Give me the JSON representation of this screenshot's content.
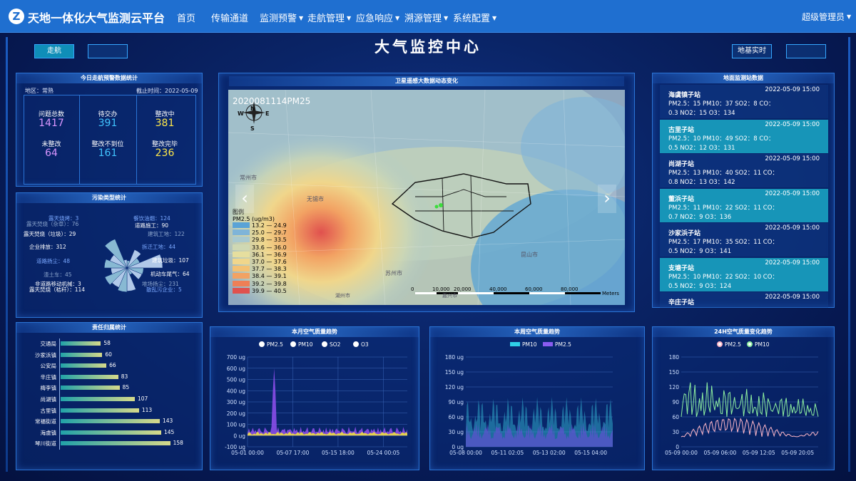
{
  "app": {
    "title": "天地一体化大气监测云平台",
    "logo_glyph": "Z"
  },
  "nav": {
    "items": [
      {
        "label": "首页",
        "dropdown": false
      },
      {
        "label": "传输通道",
        "dropdown": false
      },
      {
        "label": "监测预警",
        "dropdown": true
      },
      {
        "label": "走航管理",
        "dropdown": true
      },
      {
        "label": "应急响应",
        "dropdown": true
      },
      {
        "label": "溯源管理",
        "dropdown": true
      },
      {
        "label": "系统配置",
        "dropdown": true
      }
    ],
    "user": "超级管理员"
  },
  "page": {
    "title": "大气监控中心",
    "tab_left": "走航",
    "tab_right": "地基实时"
  },
  "alarm_panel": {
    "title": "今日走航预警数据统计",
    "region": "地区：常熟",
    "deadline": "截止时间：2022-05-09",
    "stats": [
      {
        "label": "问题总数",
        "value": "1417",
        "color": "#d996ff"
      },
      {
        "label": "待交办",
        "value": "391",
        "color": "#41c4ff"
      },
      {
        "label": "整改中",
        "value": "381",
        "color": "#ffe84a"
      },
      {
        "label": "未整改",
        "value": "64",
        "color": "#d996ff"
      },
      {
        "label": "整改不到位",
        "value": "161",
        "color": "#41c4ff"
      },
      {
        "label": "整改完毕",
        "value": "236",
        "color": "#ffe84a"
      }
    ]
  },
  "pollution_panel": {
    "title": "污染类型统计",
    "items": [
      {
        "text": "露天烧烤：3",
        "value": 3,
        "color": "#7aa8ff"
      },
      {
        "text": "露天焚烧（杂草）：76",
        "value": 76,
        "color": "#8ba5cc"
      },
      {
        "text": "露天焚烧（垃圾）：29",
        "value": 29,
        "color": "#ffffff"
      },
      {
        "text": "企业排放：312",
        "value": 312,
        "color": "#ffffff"
      },
      {
        "text": "道路扬尘：48",
        "value": 48,
        "color": "#7aa8ff"
      },
      {
        "text": "渣土车：45",
        "value": 45,
        "color": "#8ba5cc"
      },
      {
        "text": "非道路移动机械：3",
        "value": 3,
        "color": "#ffffff"
      },
      {
        "text": "露天焚烧（秸秆）：114",
        "value": 114,
        "color": "#ffffff"
      },
      {
        "text": "餐饮油烟：124",
        "value": 124,
        "color": "#7aa8ff"
      },
      {
        "text": "道路施工：90",
        "value": 90,
        "color": "#ffffff"
      },
      {
        "text": "建筑工地：122",
        "value": 122,
        "color": "#8ba5cc"
      },
      {
        "text": "拆迁工地：44",
        "value": 44,
        "color": "#7aa8ff"
      },
      {
        "text": "建筑垃圾：107",
        "value": 107,
        "color": "#ffffff"
      },
      {
        "text": "机动车尾气：64",
        "value": 64,
        "color": "#ffffff"
      },
      {
        "text": "堆场扬尘：231",
        "value": 231,
        "color": "#8ba5cc"
      },
      {
        "text": "散乱污企业：5",
        "value": 5,
        "color": "#7aa8ff"
      }
    ]
  },
  "map_panel": {
    "title": "卫星遥感大数据动态变化",
    "stamp": "2020081114PM25",
    "compass": {
      "n": "N",
      "s": "S",
      "e": "E",
      "w": "W"
    },
    "prev_label": "‹",
    "next_label": "›",
    "legend_title": "图例",
    "legend_unit": "PM2.5 (ug/m3)",
    "legend": [
      {
        "range": "13.2 — 24.9",
        "color": "#5aa3d6"
      },
      {
        "range": "25.0 — 29.7",
        "color": "#7fb4d8"
      },
      {
        "range": "29.8 — 33.5",
        "color": "#a9c9cf"
      },
      {
        "range": "33.6 — 36.0",
        "color": "#cfd8b3"
      },
      {
        "range": "36.1 — 36.9",
        "color": "#e6de9e"
      },
      {
        "range": "37.0 — 37.6",
        "color": "#f0d68b"
      },
      {
        "range": "37.7 — 38.3",
        "color": "#f3c173"
      },
      {
        "range": "38.4 — 39.1",
        "color": "#f2a263"
      },
      {
        "range": "39.2 — 39.8",
        "color": "#ee7f56"
      },
      {
        "range": "39.9 — 40.5",
        "color": "#e0514e"
      }
    ],
    "scale_ticks": [
      "0",
      "10,000",
      "20,000",
      "40,000",
      "60,000",
      "80,000"
    ],
    "scale_unit": "Meters",
    "place_labels": [
      "常州市",
      "无锡市",
      "苏州市",
      "昆山市",
      "嘉兴市",
      "湖州市"
    ]
  },
  "station_panel": {
    "title": "地面监测站数据",
    "stations": [
      {
        "name": "海虞镇子站",
        "time": "2022-05-09 15:00",
        "line1": "PM2.5：15 PM10：37 SO2：8 CO：",
        "line2": "0.3 NO2：15 O3：134",
        "highlight": false
      },
      {
        "name": "古里子站",
        "time": "2022-05-09 15:00",
        "line1": "PM2.5：10 PM10：49 SO2：8 CO：",
        "line2": "0.5 NO2：12 O3：131",
        "highlight": true
      },
      {
        "name": "尚湖子站",
        "time": "2022-05-09 15:00",
        "line1": "PM2.5：13 PM10：40 SO2：11 CO：",
        "line2": "0.8 NO2：13 O3：142",
        "highlight": false
      },
      {
        "name": "董浜子站",
        "time": "2022-05-09 15:00",
        "line1": "PM2.5：11 PM10：22 SO2：11 CO：",
        "line2": "0.7 NO2：9 O3：136",
        "highlight": true
      },
      {
        "name": "沙家浜子站",
        "time": "2022-05-09 15:00",
        "line1": "PM2.5：17 PM10：35 SO2：11 CO：",
        "line2": "0.5 NO2：9 O3：141",
        "highlight": false
      },
      {
        "name": "支塘子站",
        "time": "2022-05-09 15:00",
        "line1": "PM2.5：10 PM10：22 SO2：10 CO：",
        "line2": "0.5 NO2：9 O3：124",
        "highlight": true
      },
      {
        "name": "辛庄子站",
        "time": "2022-05-09 15:00",
        "line1": "",
        "line2": "",
        "highlight": false
      }
    ]
  },
  "responsibility_panel": {
    "title": "责任归属统计",
    "categories": [
      "交通局",
      "沙家浜镇",
      "公安局",
      "辛庄镇",
      "梅李镇",
      "尚湖镇",
      "古里镇",
      "常福街道",
      "海虞镇",
      "琴川街道"
    ],
    "values": [
      58,
      60,
      66,
      83,
      85,
      107,
      113,
      143,
      145,
      158
    ],
    "max": 180
  },
  "month_chart": {
    "title": "本月空气质量趋势",
    "legend": [
      {
        "name": "PM2.5",
        "color": "#ffffff"
      },
      {
        "name": "PM10",
        "color": "#ffffff"
      },
      {
        "name": "SO2",
        "color": "#ffffff"
      },
      {
        "name": "O3",
        "color": "#ffffff"
      }
    ],
    "y_ticks": [
      "700 ug",
      "600 ug",
      "500 ug",
      "400 ug",
      "300 ug",
      "200 ug",
      "100 ug",
      "0 ug",
      "-100 ug"
    ],
    "x_ticks": [
      "05-01 00:00",
      "05-07 17:00",
      "05-15 18:00",
      "05-24 00:05"
    ]
  },
  "week_chart": {
    "title": "本周空气质量趋势",
    "legend": [
      {
        "name": "PM10",
        "color": "#2fd0e8"
      },
      {
        "name": "PM2.5",
        "color": "#8a5cf0"
      }
    ],
    "y_ticks": [
      "180 ug",
      "150 ug",
      "120 ug",
      "90 ug",
      "60 ug",
      "30 ug",
      "0 ug"
    ],
    "x_ticks": [
      "05-08 00:00",
      "05-11 02:05",
      "05-13 02:00",
      "05-15 04:00"
    ]
  },
  "day_chart": {
    "title": "24H空气质量变化趋势",
    "legend": [
      {
        "name": "PM2.5",
        "color": "#ffb8c8"
      },
      {
        "name": "PM10",
        "color": "#8ff0a0"
      }
    ],
    "y_ticks": [
      "180",
      "150",
      "120",
      "90",
      "60",
      "30",
      "0"
    ],
    "x_ticks": [
      "05-09 00:00",
      "05-09 06:00",
      "05-09 12:05",
      "05-09 20:05"
    ]
  }
}
